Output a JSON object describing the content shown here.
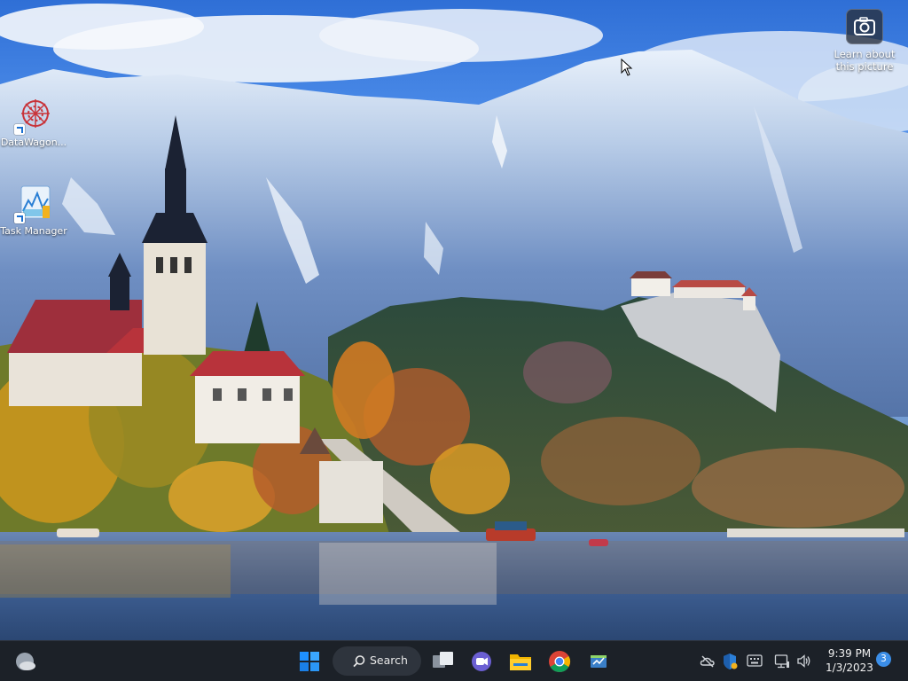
{
  "desktop": {
    "icons": [
      {
        "label": "DataWagon...",
        "icon": "datawagon-icon"
      },
      {
        "label": "Task Manager",
        "icon": "task-manager-icon"
      }
    ],
    "spotlight": {
      "label": "Learn about this picture",
      "icon": "camera-icon"
    }
  },
  "taskbar": {
    "widgets_icon": "weather-widget-icon",
    "start_icon": "windows-start-icon",
    "search_label": "Search",
    "pinned": [
      {
        "name": "Task View",
        "icon": "task-view-icon"
      },
      {
        "name": "Meet",
        "icon": "video-chat-icon"
      },
      {
        "name": "File Explorer",
        "icon": "folder-icon"
      },
      {
        "name": "Google Chrome",
        "icon": "chrome-icon"
      },
      {
        "name": "App",
        "icon": "app-window-icon"
      }
    ],
    "tray": {
      "icons": [
        "onedrive-icon",
        "security-shield-icon",
        "keyboard-icon",
        "network-icon",
        "volume-icon"
      ],
      "time": "9:39 PM",
      "date": "1/3/2023",
      "notification_count": "3"
    }
  },
  "colors": {
    "taskbar_bg": "#1c2128",
    "accent": "#3b8ee8",
    "start_blue": "#1e90ff"
  }
}
